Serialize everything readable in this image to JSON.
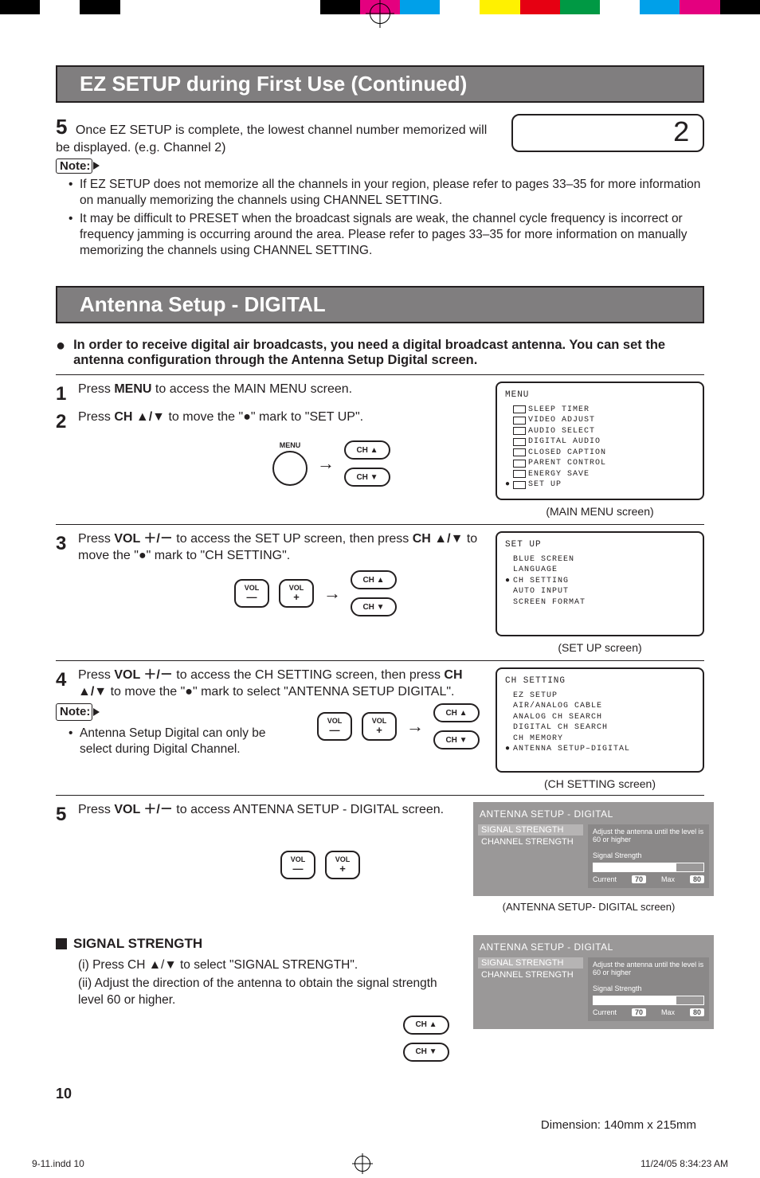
{
  "color_bar": [
    "#000000",
    "#ffffff",
    "#000000",
    "#ffffff",
    "#ffffff",
    "#ffffff",
    "#ffffff",
    "#ffffff",
    "#000000",
    "#e4007f",
    "#00a0e9",
    "#ffffff",
    "#fff100",
    "#e60012",
    "#009944",
    "#ffffff",
    "#00a0e9",
    "#e4007f",
    "#000000"
  ],
  "section1": {
    "title": "EZ SETUP during First Use (Continued)",
    "step5_num": "5",
    "step5_text": "Once EZ SETUP is complete, the lowest channel number memorized will be displayed. (e.g. Channel 2)",
    "channel_display": "2",
    "note_label": "Note:",
    "notes": [
      "If EZ SETUP does not memorize all the channels in your region, please refer to pages 33–35 for more information on manually memorizing the channels using CHANNEL SETTING.",
      "It may be difficult to PRESET when the broadcast signals are weak, the channel cycle frequency is incorrect or frequency jamming is occurring around the area. Please refer to pages 33–35 for more information on manually memorizing the channels using CHANNEL SETTING."
    ]
  },
  "section2": {
    "title": "Antenna Setup - DIGITAL",
    "lead": "In order to receive digital air broadcasts, you need a digital broadcast antenna. You can set the antenna configuration through the Antenna Setup Digital screen.",
    "steps": [
      {
        "n": "1",
        "text_pre": "Press ",
        "bold": "MENU",
        "text_post": " to access the MAIN MENU screen."
      },
      {
        "n": "2",
        "text_pre": "Press ",
        "bold": "CH ▲/▼",
        "text_post": " to move the \"●\" mark to \"SET UP\"."
      },
      {
        "n": "3",
        "text_pre": "Press ",
        "bold": "VOL ＋/－",
        "text_post": " to access the SET UP screen, then press ",
        "bold2": "CH ▲/▼",
        "text_post2": " to move the \"●\" mark to \"CH SETTING\"."
      },
      {
        "n": "4",
        "text_pre": "Press ",
        "bold": "VOL ＋/－",
        "text_post": " to access the CH SETTING screen, then press ",
        "bold2": "CH ▲/▼",
        "text_post2": " to move the \"●\" mark to select \"ANTENNA SETUP DIGITAL\"."
      },
      {
        "n": "5",
        "text_pre": "Press ",
        "bold": "VOL ＋/－",
        "text_post": " to access ANTENNA SETUP - DIGITAL screen."
      }
    ],
    "note_label": "Note:",
    "note4": "Antenna Setup Digital can only be select during Digital Channel.",
    "buttons": {
      "menu": "MENU",
      "ch_up": "CH ▲",
      "ch_down": "CH ▼",
      "vol_minus_top": "VOL",
      "vol_minus_bot": "—",
      "vol_plus_top": "VOL",
      "vol_plus_bot": "+",
      "arrow": "→"
    },
    "osd_main": {
      "title": "MENU",
      "items": [
        "SLEEP TIMER",
        "VIDEO ADJUST",
        "AUDIO SELECT",
        "DIGITAL AUDIO",
        "CLOSED CAPTION",
        "PARENT CONTROL",
        "ENERGY SAVE",
        "SET UP"
      ],
      "selected": 7,
      "caption": "(MAIN MENU screen)"
    },
    "osd_setup": {
      "title": "SET  UP",
      "items": [
        "BLUE  SCREEN",
        "LANGUAGE",
        "CH  SETTING",
        "AUTO  INPUT",
        "SCREEN   FORMAT"
      ],
      "selected": 2,
      "caption": "(SET UP screen)"
    },
    "osd_ch": {
      "title": "CH  SETTING",
      "items": [
        "EZ SETUP",
        "AIR/ANALOG  CABLE",
        "ANALOG  CH SEARCH",
        "DIGITAL  CH SEARCH",
        "CH MEMORY",
        "ANTENNA  SETUP–DIGITAL"
      ],
      "selected": 5,
      "caption": "(CH SETTING screen)"
    },
    "antenna_panel": {
      "title": "ANTENNA SETUP - DIGITAL",
      "left": [
        "SIGNAL STRENGTH",
        "CHANNEL STRENGTH"
      ],
      "hint": "Adjust the antenna until the level is 60 or higher",
      "gauge_label": "Signal Strength",
      "current_label": "Current",
      "current_val": "70",
      "max_label": "Max",
      "max_val": "80",
      "caption": "(ANTENNA SETUP- DIGITAL screen)"
    },
    "signal_strength": {
      "heading": "SIGNAL STRENGTH",
      "i": "(i)  Press CH ▲/▼ to select \"SIGNAL STRENGTH\".",
      "ii": "(ii) Adjust the direction of the antenna to obtain the signal strength level 60 or higher."
    }
  },
  "page_number": "10",
  "dimension": "Dimension: 140mm x 215mm",
  "footer": {
    "file": "9-11.indd   10",
    "date": "11/24/05   8:34:23 AM"
  }
}
